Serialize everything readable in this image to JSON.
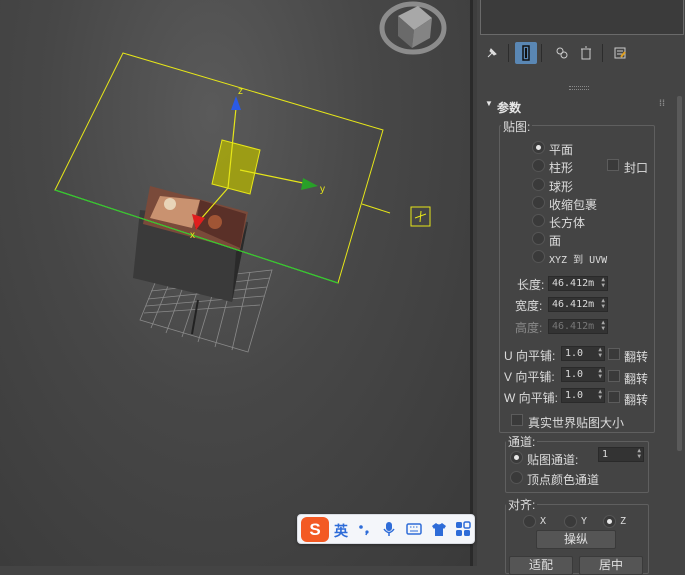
{
  "panel": {
    "rollout_title": "参数",
    "mapping": {
      "group_label": "贴图:",
      "options": [
        "平面",
        "柱形",
        "球形",
        "收缩包裹",
        "长方体",
        "面",
        "XYZ 到 UVW"
      ],
      "selected": "平面",
      "cap_label": "封口"
    },
    "dimensions": {
      "length_label": "长度:",
      "length_value": "46.412m",
      "width_label": "宽度:",
      "width_value": "46.412m",
      "height_label": "高度:",
      "height_value": "46.412m"
    },
    "tiling": {
      "u_label": "U 向平铺:",
      "u_value": "1.0",
      "v_label": "V 向平铺:",
      "v_value": "1.0",
      "w_label": "W 向平铺:",
      "w_value": "1.0",
      "flip_label": "翻转"
    },
    "real_world_label": "真实世界贴图大小",
    "channel": {
      "group_label": "通道:",
      "map_channel_label": "贴图通道:",
      "map_channel_value": "1",
      "vertex_color_label": "顶点颜色通道"
    },
    "alignment": {
      "group_label": "对齐:",
      "axes": [
        "X",
        "Y",
        "Z"
      ],
      "selected": "Z",
      "manipulate_label": "操纵",
      "fit_label": "适配",
      "center_label": "居中"
    }
  },
  "viewport": {
    "axis_labels": {
      "x": "x",
      "y": "y",
      "z": "z"
    }
  },
  "ime": {
    "logo": "S",
    "lang": "英",
    "icons": [
      "punctuation-icon",
      "microphone-icon",
      "keyboard-icon",
      "skin-icon",
      "toolbox-icon"
    ]
  },
  "colors": {
    "gizmo_yellow": "#e6e619",
    "active_tool": "#5a87b4",
    "ime_logo": "#f35a24"
  }
}
